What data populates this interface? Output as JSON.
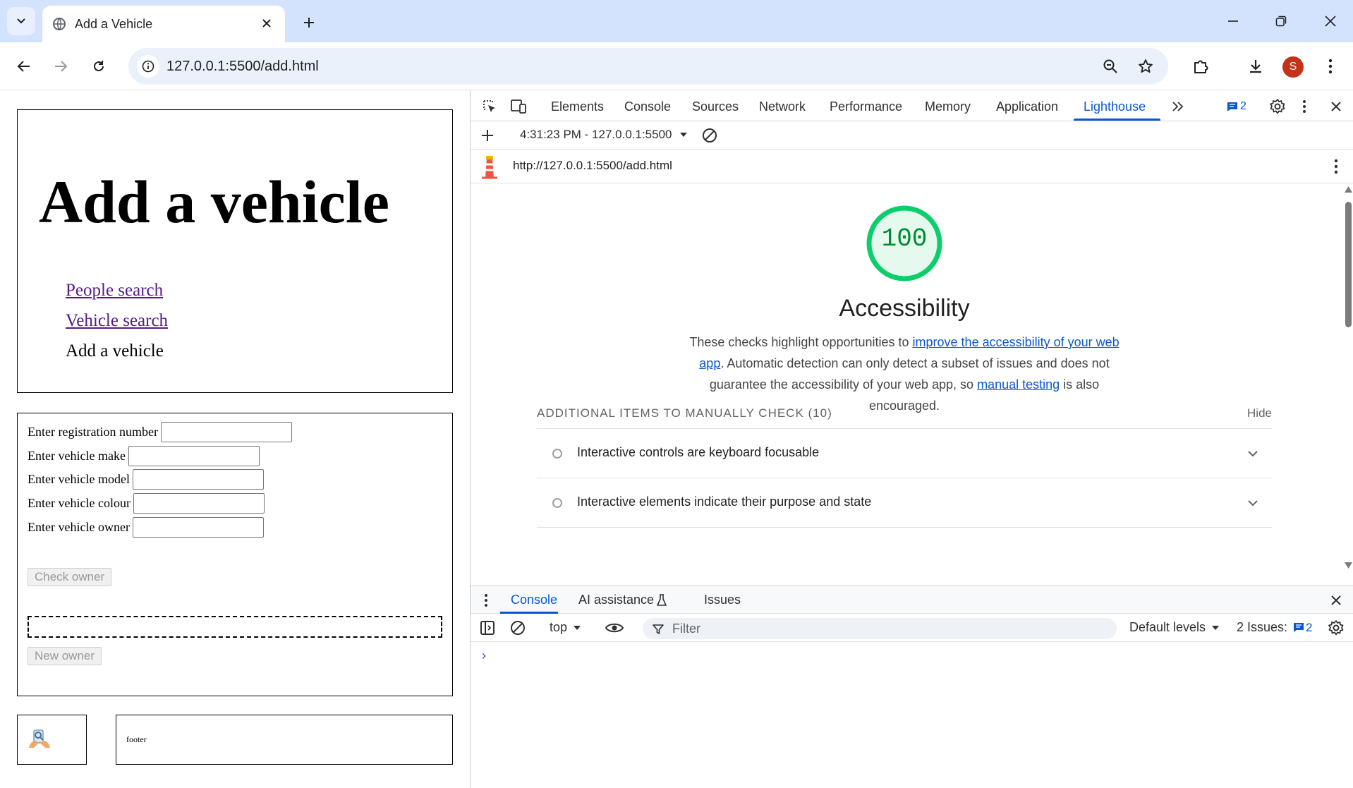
{
  "browser": {
    "tab_title": "Add a Vehicle",
    "url": "127.0.0.1:5500/add.html",
    "profile_initial": "S"
  },
  "page": {
    "heading": "Add a vehicle",
    "nav": [
      "People search",
      "Vehicle search",
      "Add a vehicle"
    ],
    "form": {
      "reg_label": "Enter registration number",
      "make_label": "Enter vehicle make",
      "model_label": "Enter vehicle model",
      "colour_label": "Enter vehicle colour",
      "owner_label": "Enter vehicle owner",
      "check_owner": "Check owner",
      "new_owner": "New owner"
    },
    "footer_text": "footer"
  },
  "devtools": {
    "tabs": [
      "Elements",
      "Console",
      "Sources",
      "Network",
      "Performance",
      "Memory",
      "Application",
      "Lighthouse"
    ],
    "active_tab": "Lighthouse",
    "issues_badge": "2",
    "report_selector": "4:31:23 PM - 127.0.0.1:5500",
    "report_url": "http://127.0.0.1:5500/add.html",
    "lighthouse": {
      "score": "100",
      "score_color": "#0cce6b",
      "category": "Accessibility",
      "desc_1": "These checks highlight opportunities to ",
      "desc_link_1": "improve the accessibility of your web app",
      "desc_2": ". Automatic detection can only detect a subset of issues and does not guarantee the accessibility of your web app, so ",
      "desc_link_2": "manual testing",
      "desc_3": " is also encouraged.",
      "group_title": "ADDITIONAL ITEMS TO MANUALLY CHECK",
      "group_count": "(10)",
      "group_toggle": "Hide",
      "audits": [
        "Interactive controls are keyboard focusable",
        "Interactive elements indicate their purpose and state"
      ]
    },
    "drawer": {
      "tabs": [
        "Console",
        "AI assistance",
        "Issues"
      ],
      "context": "top",
      "filter_placeholder": "Filter",
      "levels": "Default levels",
      "issues_label": "2 Issues:",
      "issues_count": "2",
      "prompt": "›"
    }
  }
}
